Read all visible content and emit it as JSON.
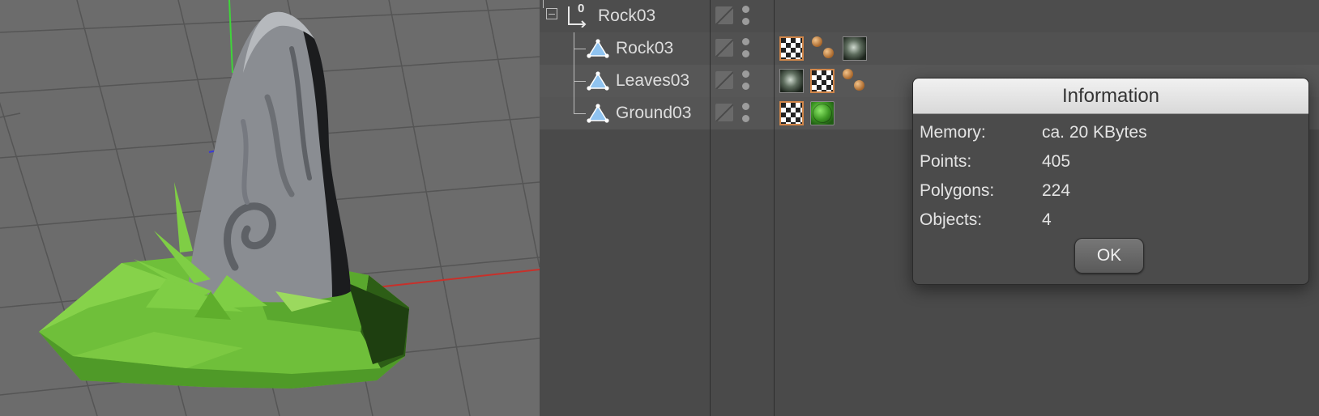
{
  "outliner": {
    "objects": [
      {
        "name": "Rock03",
        "type": "null",
        "badge": "0",
        "level": 0
      },
      {
        "name": "Rock03",
        "type": "polygon",
        "level": 1
      },
      {
        "name": "Leaves03",
        "type": "polygon",
        "level": 1
      },
      {
        "name": "Ground03",
        "type": "polygon",
        "level": 1
      }
    ]
  },
  "dialog": {
    "title": "Information",
    "fields": [
      {
        "label": "Memory:",
        "value": "ca. 20 KBytes"
      },
      {
        "label": "Points:",
        "value": "405"
      },
      {
        "label": "Polygons:",
        "value": "224"
      },
      {
        "label": "Objects:",
        "value": "4"
      }
    ],
    "ok_label": "OK"
  },
  "colors": {
    "viewport_bg": "#6c6c6c",
    "grass": "#6fbf3a",
    "rock": "#8a8d92",
    "axis_x": "#c8302a",
    "axis_y": "#3fd43a",
    "selection_accent": "#d2874a"
  },
  "icons": {
    "null_object": "null-axis-icon",
    "polygon_object": "polygon-triangle-icon",
    "expand": "collapse-minus-icon",
    "texture_tag": "checker-texture-tag-icon",
    "material_tag": "material-sphere-icon"
  }
}
